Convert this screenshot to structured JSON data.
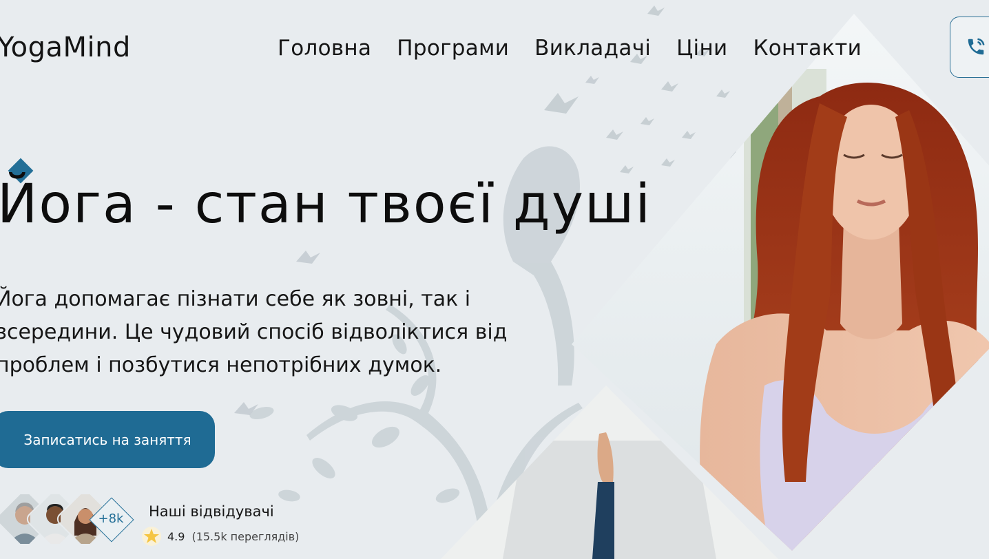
{
  "brand": {
    "name": "YogaMind"
  },
  "nav": {
    "items": [
      "Головна",
      "Програми",
      "Викладачі",
      "Ціни",
      "Контакти"
    ]
  },
  "hero": {
    "title": "Йога - стан твоєї душі",
    "description": "Йога допомагає пізнати себе як зовні, так і зсередини. Це чудовий спосіб відволіктися від проблем і позбутися непотрібних думок.",
    "cta_label": "Записатись на заняття"
  },
  "visitors": {
    "title": "Наші відвідувачі",
    "more_count": "+8k",
    "rating": "4.9",
    "reviews": "(15.5k переглядів)"
  },
  "icons": {
    "phone": "phone-icon",
    "star": "star-icon"
  },
  "colors": {
    "accent": "#1f6b94",
    "background": "#e8ecef",
    "text": "#111111"
  }
}
